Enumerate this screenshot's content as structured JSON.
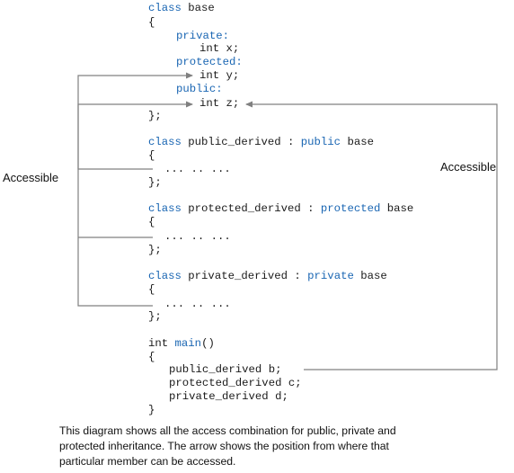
{
  "code": {
    "class_keyword": "class",
    "base_name": "base",
    "open_brace": "{",
    "close_brace": "}",
    "close_brace_semi": "};",
    "private_label": "private:",
    "int_x": "int x;",
    "protected_label": "protected:",
    "int_y": "int y;",
    "public_label": "public:",
    "int_z": "int z;",
    "public_derived_name": "public_derived",
    "protected_derived_name": "protected_derived",
    "private_derived_name": "private_derived",
    "colon": ":",
    "public_kw": "public",
    "protected_kw": "protected",
    "private_kw": "private",
    "ellipsis": "... .. ...",
    "int_kw": "int",
    "main_name": "main",
    "parens": "()",
    "decl_b": "public_derived b;",
    "decl_c": "protected_derived c;",
    "decl_d": "private_derived d;"
  },
  "labels": {
    "left": "Accessible",
    "right": "Accessible"
  },
  "caption": {
    "line1": "This diagram shows all the access combination for public, private and",
    "line2": "protected inheritance. The arrow shows the position from where that",
    "line3": "particular member can be accessed."
  },
  "colors": {
    "keyword": "#1a66b3",
    "text": "#1a1a1a",
    "arrow": "#808080"
  }
}
